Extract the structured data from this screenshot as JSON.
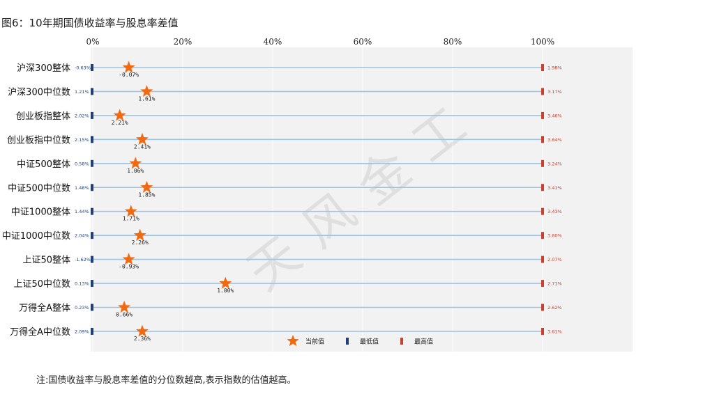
{
  "title": "图6：10年期国债收益率与股息率差值",
  "note": "注:国债收益率与股息率差值的分位数越高,表示指数的估值越高。",
  "watermark": "天风金工",
  "colors": {
    "star": "#F26A10",
    "min_marker": "#1F3F7A",
    "max_marker": "#C8402F",
    "min_label": "#1F3F7A",
    "max_label": "#C8402F",
    "track_line": "#9DC3E6",
    "plot_bg": "#F2F2F2"
  },
  "chart_data": {
    "type": "scatter",
    "title": "图6：10年期国债收益率与股息率差值",
    "x_axis": {
      "range": [
        0,
        100
      ],
      "ticks": [
        0,
        20,
        40,
        60,
        80,
        100
      ],
      "tick_labels": [
        "0%",
        "20%",
        "40%",
        "60%",
        "80%",
        "100%"
      ],
      "position": "top"
    },
    "grid": true,
    "legend": {
      "placement": "bottom",
      "entries": [
        {
          "label": "当前值",
          "marker": "star"
        },
        {
          "label": "最低值",
          "marker": "min-bar"
        },
        {
          "label": "最高值",
          "marker": "max-bar"
        }
      ]
    },
    "rows": [
      {
        "label": "沪深300整体",
        "percentile": 8,
        "current": "-0.07%",
        "min": "-0.63%",
        "max": "1.98%"
      },
      {
        "label": "沪深300中位数",
        "percentile": 12,
        "current": "1.61%",
        "min": "1.21%",
        "max": "3.17%"
      },
      {
        "label": "创业板指整体",
        "percentile": 6,
        "current": "2.21%",
        "min": "2.02%",
        "max": "3.46%"
      },
      {
        "label": "创业板指中位数",
        "percentile": 11,
        "current": "2.41%",
        "min": "2.15%",
        "max": "3.64%"
      },
      {
        "label": "中证500整体",
        "percentile": 9.5,
        "current": "1.06%",
        "min": "0.58%",
        "max": "3.24%"
      },
      {
        "label": "中证500中位数",
        "percentile": 12,
        "current": "1.85%",
        "min": "1.48%",
        "max": "3.41%"
      },
      {
        "label": "中证1000整体",
        "percentile": 8.5,
        "current": "1.71%",
        "min": "1.44%",
        "max": "3.43%"
      },
      {
        "label": "中证1000中位数",
        "percentile": 10.5,
        "current": "2.26%",
        "min": "2.04%",
        "max": "3.60%"
      },
      {
        "label": "上证50整体",
        "percentile": 8,
        "current": "-0.93%",
        "min": "-1.62%",
        "max": "2.07%"
      },
      {
        "label": "上证50中位数",
        "percentile": 29.5,
        "current": "1.00%",
        "min": "0.13%",
        "max": "2.71%"
      },
      {
        "label": "万得全A整体",
        "percentile": 7,
        "current": "0.66%",
        "min": "0.23%",
        "max": "2.62%"
      },
      {
        "label": "万得全A中位数",
        "percentile": 11,
        "current": "2.36%",
        "min": "2.09%",
        "max": "3.61%"
      }
    ]
  }
}
